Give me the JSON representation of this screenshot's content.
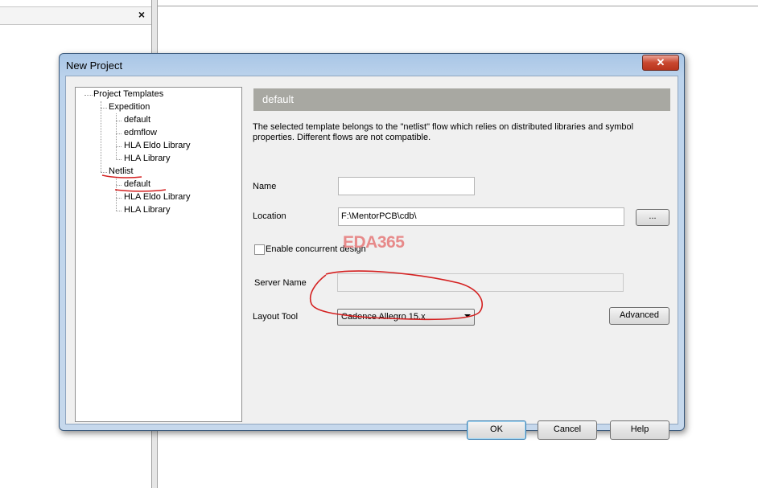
{
  "background": {
    "close_glyph": "×"
  },
  "dialog": {
    "title": "New Project",
    "close_glyph": "✕"
  },
  "tree": {
    "root": "Project Templates",
    "groups": [
      {
        "label": "Expedition",
        "children": [
          "default",
          "edmflow",
          "HLA Eldo Library",
          "HLA Library"
        ]
      },
      {
        "label": "Netlist",
        "children": [
          "default",
          "HLA Eldo Library",
          "HLA Library"
        ]
      }
    ]
  },
  "panel": {
    "header": "default",
    "description": "The selected template belongs to the \"netlist\" flow which relies on distributed libraries and symbol properties. Different flows are not compatible.",
    "name_label": "Name",
    "name_value": "",
    "location_label": "Location",
    "location_value": "F:\\MentorPCB\\cdb\\",
    "browse_label": "...",
    "concurrent_label": "Enable concurrent design",
    "concurrent_checked": false,
    "server_label": "Server Name",
    "server_value": "",
    "layout_tool_label": "Layout Tool",
    "layout_tool_value": "Cadence Allegro 15.x",
    "advanced_label": "Advanced"
  },
  "buttons": {
    "ok": "OK",
    "cancel": "Cancel",
    "help": "Help"
  },
  "watermark": "EDA365",
  "colors": {
    "annotation": "#d42020",
    "panel_header": "#a8a8a2",
    "watermark": "#e78a8a"
  }
}
